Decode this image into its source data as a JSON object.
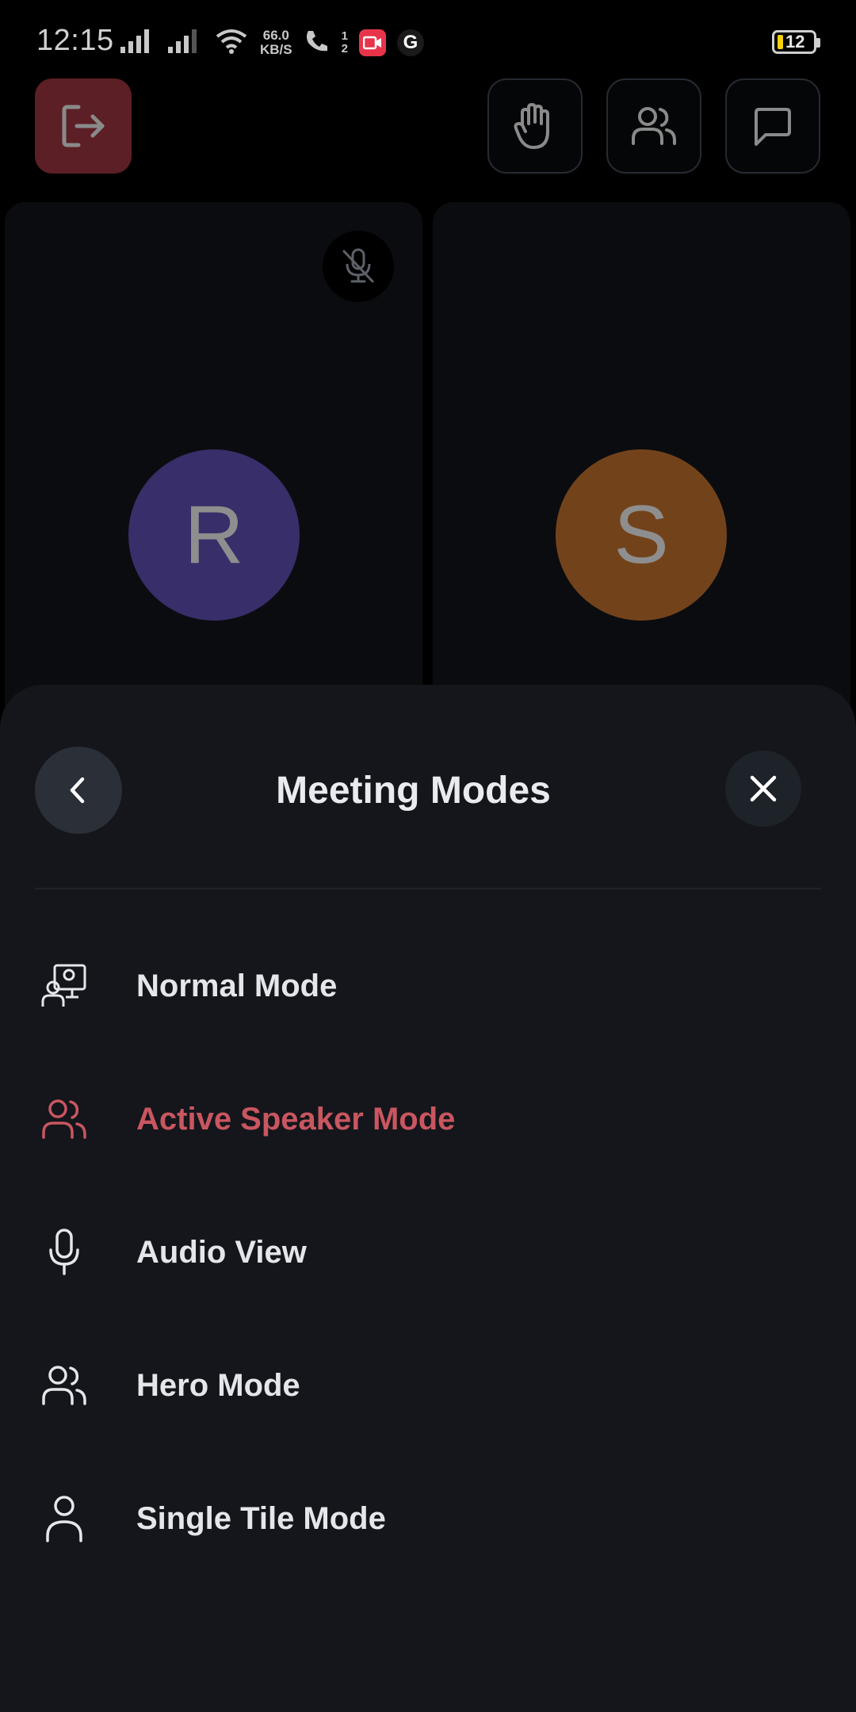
{
  "status_bar": {
    "time": "12:15",
    "net_speed_value": "66.0",
    "net_speed_unit": "KB/S",
    "sim_slot_1": "1",
    "sim_slot_2": "2",
    "battery_level": "12",
    "google_icon_letter": "G"
  },
  "participants": [
    {
      "initial": "R",
      "color": "#372e6a",
      "muted": true
    },
    {
      "initial": "S",
      "color": "#72431b",
      "muted": false
    }
  ],
  "sheet": {
    "title": "Meeting Modes",
    "modes": [
      {
        "label": "Normal Mode",
        "icon": "screen-share-person-icon",
        "active": false
      },
      {
        "label": "Active Speaker Mode",
        "icon": "people-icon",
        "active": true
      },
      {
        "label": "Audio View",
        "icon": "microphone-icon",
        "active": false
      },
      {
        "label": "Hero Mode",
        "icon": "people-icon",
        "active": false
      },
      {
        "label": "Single Tile Mode",
        "icon": "person-icon",
        "active": false
      }
    ]
  },
  "colors": {
    "active_mode": "#c95660",
    "leave_button": "#5c1f25"
  }
}
